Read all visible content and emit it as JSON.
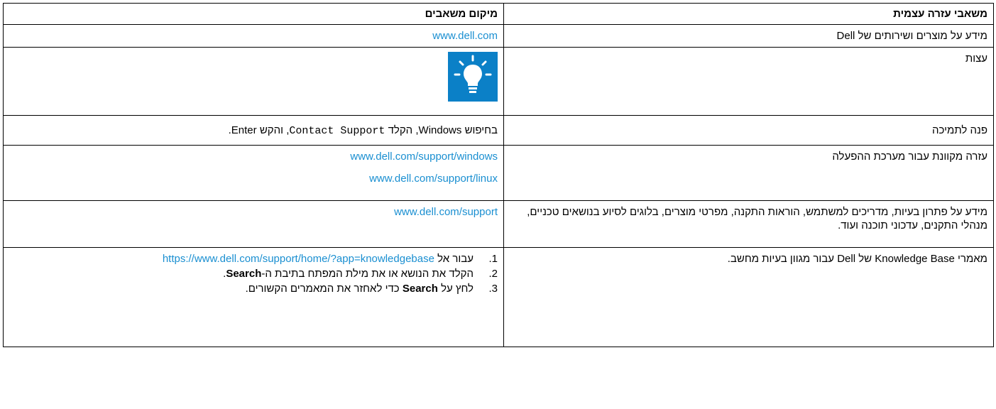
{
  "header": {
    "col_resources": "משאבי עזרה עצמית",
    "col_location": "מיקום משאבים"
  },
  "rows": [
    {
      "resource": "מידע על מוצרים ושירותים של Dell",
      "link": "www.dell.com"
    },
    {
      "resource": "עצות",
      "icon": "lightbulb-tip-icon"
    },
    {
      "resource": "פנה לתמיכה",
      "loc_prefix": "בחיפוש",
      "loc_windows": "Windows",
      "loc_type": ", הקלד",
      "loc_command": "Contact Support",
      "loc_press": ", והקש",
      "loc_enter": "Enter."
    },
    {
      "resource": "עזרה מקוונת עבור מערכת ההפעלה",
      "links": [
        "www.dell.com/support/windows",
        "www.dell.com/support/linux"
      ]
    },
    {
      "resource": "מידע על פתרון בעיות, מדריכים למשתמש, הוראות התקנה, מפרטי מוצרים, בלוגים לסיוע בנושאים טכניים, מנהלי התקנים, עדכוני תוכנה ועוד.",
      "link": "www.dell.com/support"
    },
    {
      "resource_part1": "מאמרי",
      "resource_kb": "Knowledge Base",
      "resource_part2": "של",
      "resource_dell": "Dell",
      "resource_part3": "עבור מגוון בעיות מחשב.",
      "steps": [
        {
          "num": "1.",
          "prefix": "עבור אל",
          "link": "https://www.dell.com/support/home/?app=knowledgebase"
        },
        {
          "num": "2.",
          "prefix": "הקלד את הנושא או את מילת המפתח בתיבת ה-",
          "bold": "Search",
          "suffix": "."
        },
        {
          "num": "3.",
          "prefix": "לחץ על",
          "bold": "Search",
          "suffix": "כדי לאחזר את המאמרים הקשורים."
        }
      ]
    }
  ],
  "colors": {
    "link": "#1a8fd1",
    "tip_bg": "#0b80c7"
  }
}
